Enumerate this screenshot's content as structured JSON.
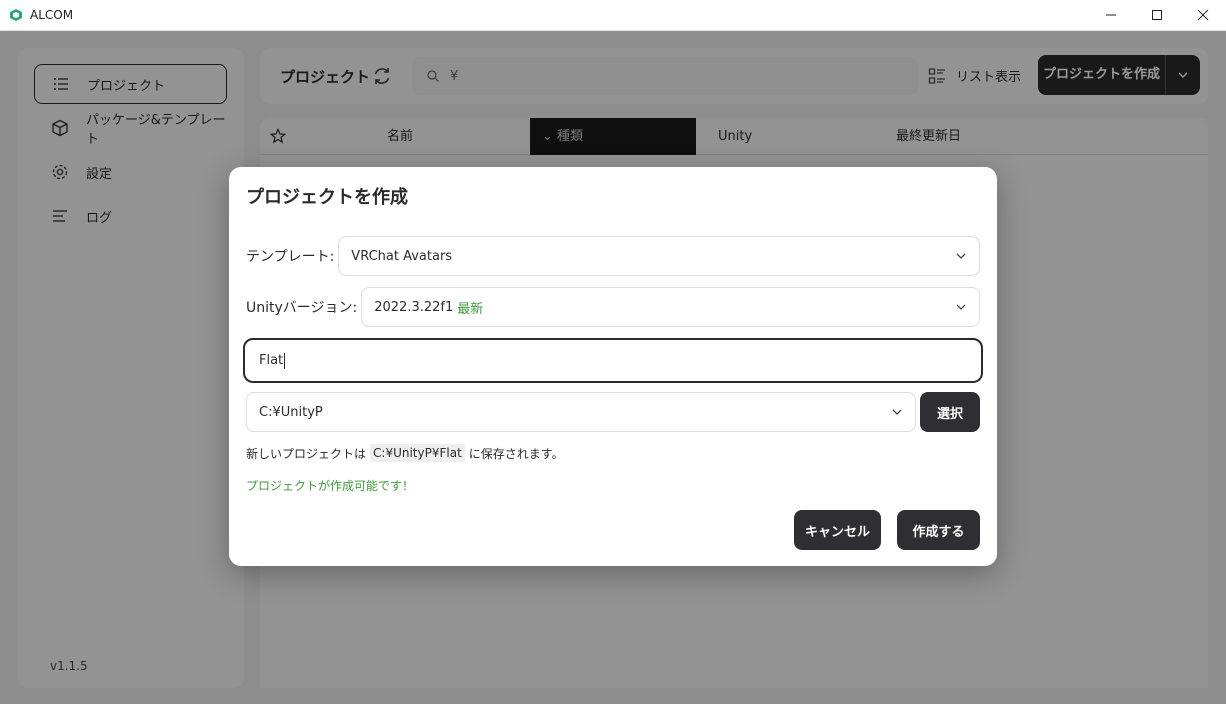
{
  "window": {
    "title": "ALCOM"
  },
  "sidebar": {
    "items": [
      {
        "label": "プロジェクト",
        "icon": "list-icon",
        "active": true
      },
      {
        "label": "パッケージ&テンプレート",
        "icon": "package-icon",
        "active": false
      },
      {
        "label": "設定",
        "icon": "gear-icon",
        "active": false
      },
      {
        "label": "ログ",
        "icon": "log-icon",
        "active": false
      }
    ],
    "version": "v1.1.5"
  },
  "toolbar": {
    "title": "プロジェクト",
    "search_value": "¥",
    "list_view_label": "リスト表示",
    "create_label": "プロジェクトを作成"
  },
  "table": {
    "headers": {
      "name": "名前",
      "type": "種類",
      "unity": "Unity",
      "updated": "最終更新日"
    }
  },
  "dialog": {
    "title": "プロジェクトを作成",
    "template_label": "テンプレート:",
    "template_value": "VRChat Avatars",
    "unity_label": "Unityバージョン:",
    "unity_value": "2022.3.22f1",
    "unity_tag": "最新",
    "name_value": "Flat",
    "path_value": "C:¥UnityP",
    "select_button": "選択",
    "save_prefix": "新しいプロジェクトは",
    "save_path": "C:¥UnityP¥Flat",
    "save_suffix": "に保存されます。",
    "status": "プロジェクトが作成可能です！",
    "cancel_button": "キャンセル",
    "create_button": "作成する"
  },
  "colors": {
    "accent_green": "#3f9a3f",
    "dark_button": "#2e2e33"
  }
}
